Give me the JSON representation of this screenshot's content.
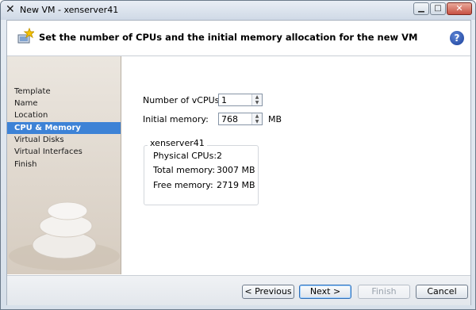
{
  "window": {
    "title": "New VM - xenserver41"
  },
  "header": {
    "title": "Set the number of CPUs and the initial memory allocation for the new VM",
    "help_glyph": "?"
  },
  "sidebar": {
    "items": [
      {
        "label": "Template"
      },
      {
        "label": "Name"
      },
      {
        "label": "Location"
      },
      {
        "label": "CPU & Memory",
        "active": true
      },
      {
        "label": "Virtual Disks"
      },
      {
        "label": "Virtual Interfaces"
      },
      {
        "label": "Finish"
      }
    ]
  },
  "form": {
    "vcpus_label": "Number of vCPUs:",
    "vcpus_value": "1",
    "memory_label": "Initial memory:",
    "memory_value": "768",
    "memory_unit": "MB"
  },
  "host_info": {
    "title": "xenserver41",
    "physical_cpus_label": "Physical CPUs:",
    "physical_cpus_value": "2",
    "total_memory_label": "Total memory:",
    "total_memory_value": "3007 MB",
    "free_memory_label": "Free memory:",
    "free_memory_value": "2719 MB"
  },
  "footer": {
    "previous_label": "< Previous",
    "next_label": "Next >",
    "finish_label": "Finish",
    "cancel_label": "Cancel"
  },
  "colors": {
    "accent": "#3d82d6",
    "help": "#1a3f9a"
  }
}
